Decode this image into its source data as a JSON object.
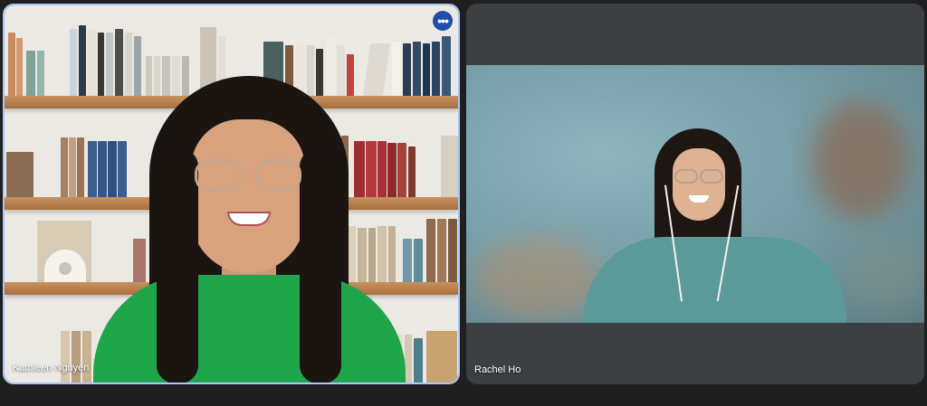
{
  "participants": [
    {
      "name": "Kathleen Nguyen",
      "more_options_glyph": "•••",
      "active_speaker": true
    },
    {
      "name": "Rachel Ho",
      "active_speaker": false
    }
  ],
  "colors": {
    "background": "#1f1f1f",
    "tile_placeholder": "#3c4043",
    "active_border": "#a8c7fa",
    "more_button": "#1d4fa8"
  },
  "icons": {
    "more_options": "more-horizontal-icon"
  }
}
